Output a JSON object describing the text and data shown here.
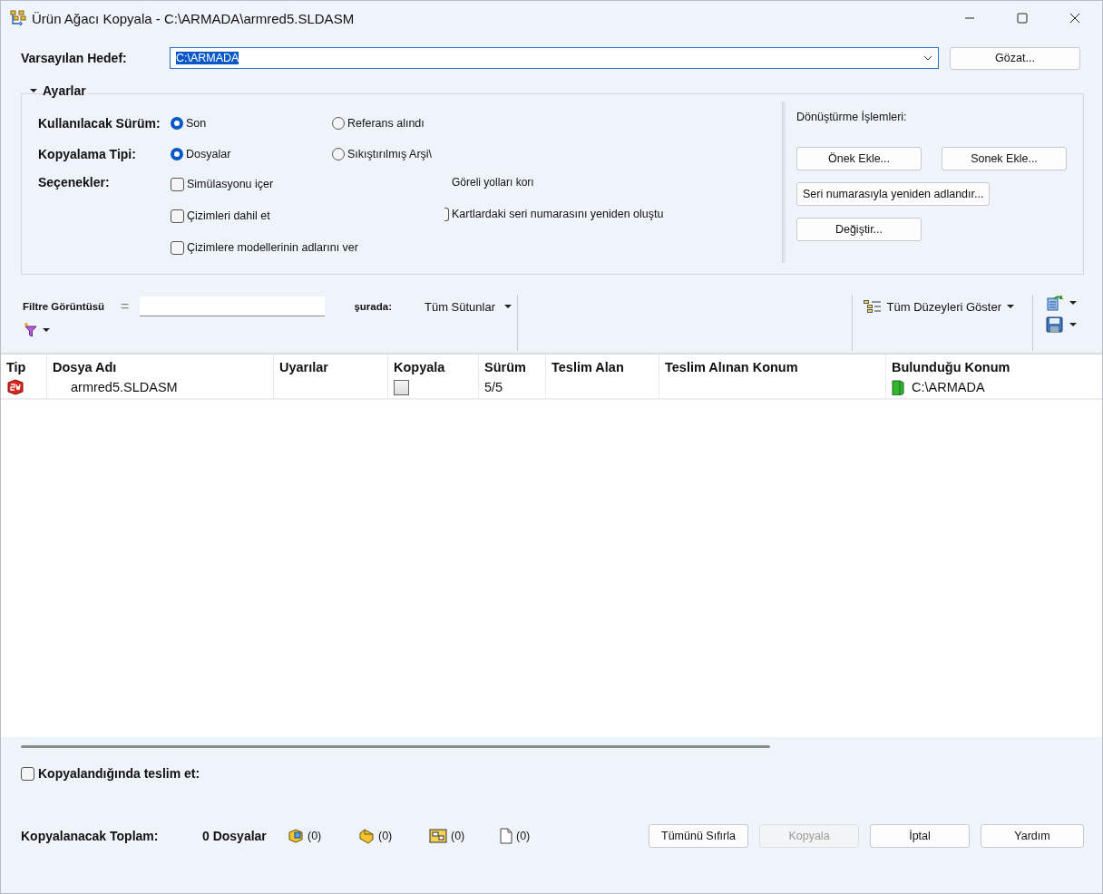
{
  "window": {
    "title": "Ürün Ağacı Kopyala - C:\\ARMADA\\armred5.SLDASM"
  },
  "destination": {
    "label": "Varsayılan Hedef:",
    "value": "C:\\ARMADA",
    "value_selected": true,
    "browse_button": "Gözat..."
  },
  "settings": {
    "title": "Ayarlar",
    "expanded": true,
    "version": {
      "label": "Kullanılacak Sürüm:",
      "options": [
        {
          "label": "Son",
          "selected": true
        },
        {
          "label": "Referans alındı",
          "selected": false
        }
      ]
    },
    "copy_type": {
      "label": "Kopyalama Tipi:",
      "options": [
        {
          "label": "Dosyalar",
          "selected": true
        },
        {
          "label": "Sıkıştırılmış Arşi\\",
          "selected": false
        }
      ]
    },
    "options": {
      "label": "Seçenekler:",
      "column_1": [
        {
          "label": "Simülasyonu içer",
          "checked": false
        },
        {
          "label": "Çizimleri dahil et",
          "checked": false
        },
        {
          "label": "Çizimlere modellerinin adlarını ver",
          "checked": false
        }
      ],
      "column_2": [
        {
          "kind": "text",
          "label": "Göreli yolları korı"
        },
        {
          "kind": "checkbox",
          "label": "Kartlardaki seri numarasını yeniden oluştu",
          "checked": false
        }
      ]
    },
    "transform": {
      "title": "Dönüştürme İşlemleri:",
      "buttons": [
        "Önek Ekle...",
        "Sonek Ekle...",
        "Seri numarasıyla yeniden adlandır...",
        "Değiştir..."
      ]
    }
  },
  "filter": {
    "label": "Filtre Görüntüsü",
    "operator": "=",
    "in_label": "şurada:",
    "columns_dropdown": "Tüm Sütunlar",
    "levels_dropdown": "Tüm Düzeyleri Göster"
  },
  "table": {
    "columns": [
      "Tip",
      "Dosya Adı",
      "Uyarılar",
      "Kopyala",
      "Sürüm",
      "Teslim Alan",
      "Teslim Alınan Konum",
      "Bulunduğu Konum"
    ],
    "rows": [
      {
        "name": "armred5.SLDASM",
        "copy": false,
        "version": "5/5",
        "location": "C:\\ARMADA"
      }
    ]
  },
  "footer": {
    "checkin": {
      "label": "Kopyalandığında teslim et:",
      "checked": false
    },
    "total_label": "Kopyalanacak Toplam:",
    "files": "0 Dosyalar",
    "counts": [
      {
        "kind": "assembly",
        "count": "(0)"
      },
      {
        "kind": "part",
        "count": "(0)"
      },
      {
        "kind": "drawing",
        "count": "(0)"
      },
      {
        "kind": "other",
        "count": "(0)"
      }
    ],
    "buttons": [
      {
        "label": "Tümünü Sıfırla",
        "disabled": false
      },
      {
        "label": "Kopyala",
        "disabled": true
      },
      {
        "label": "İptal",
        "disabled": false
      },
      {
        "label": "Yardım",
        "disabled": false
      }
    ]
  }
}
